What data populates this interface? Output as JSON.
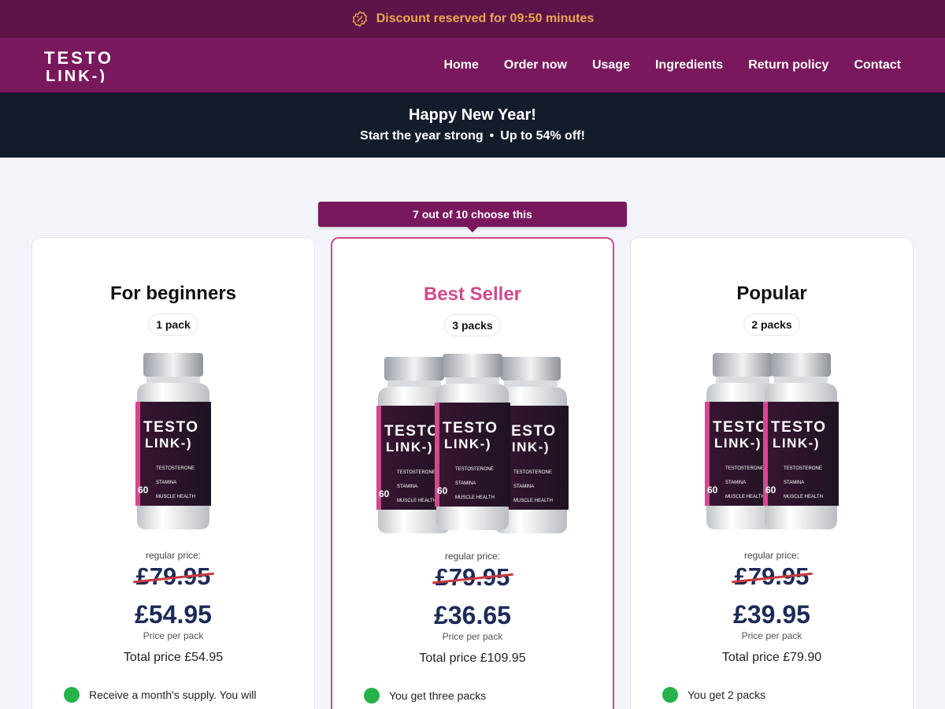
{
  "topbar": {
    "timer_text": "Discount reserved for 09:50 minutes",
    "icon": "timer-badge-icon"
  },
  "brand": {
    "logo_line1": "TESTO",
    "logo_line2": "LINK-)"
  },
  "nav": {
    "items": [
      "Home",
      "Order now",
      "Usage",
      "Ingredients",
      "Return policy",
      "Contact"
    ]
  },
  "promo": {
    "title": "Happy New Year!",
    "subtitle_left": "Start the year strong",
    "separator": "•",
    "subtitle_right": "Up to 54% off!"
  },
  "highlight_tag": "7 out of 10 choose this",
  "colors": {
    "topbar": "#5e1449",
    "nav": "#79185d",
    "promo": "#141b2b",
    "accent_pink": "#d24a8e",
    "price_navy": "#1c2a56",
    "strike_red": "#c93a3f",
    "check_green": "#27b24a",
    "timer_gold": "#e9a94f"
  },
  "bottle_label": {
    "brand1": "TESTO",
    "brand2": "LINK-)",
    "count": "60",
    "features": [
      "TESTOSTERONE",
      "STAMINA",
      "MUSCLE HEALTH"
    ]
  },
  "cards": [
    {
      "title": "For beginners",
      "packs": "1 pack",
      "bottle_count": 1,
      "regular_label": "regular price:",
      "old_price": "£79.95",
      "price": "£54.95",
      "per_pack": "Price per pack",
      "total": "Total price £54.95",
      "feature": "Receive a month's supply. You will"
    },
    {
      "title": "Best Seller",
      "packs": "3 packs",
      "bottle_count": 3,
      "regular_label": "regular price:",
      "old_price": "£79.95",
      "price": "£36.65",
      "per_pack": "Price per pack",
      "total": "Total price £109.95",
      "feature": "You get three packs"
    },
    {
      "title": "Popular",
      "packs": "2 packs",
      "bottle_count": 2,
      "regular_label": "regular price:",
      "old_price": "£79.95",
      "price": "£39.95",
      "per_pack": "Price per pack",
      "total": "Total price £79.90",
      "feature": "You get 2 packs"
    }
  ]
}
